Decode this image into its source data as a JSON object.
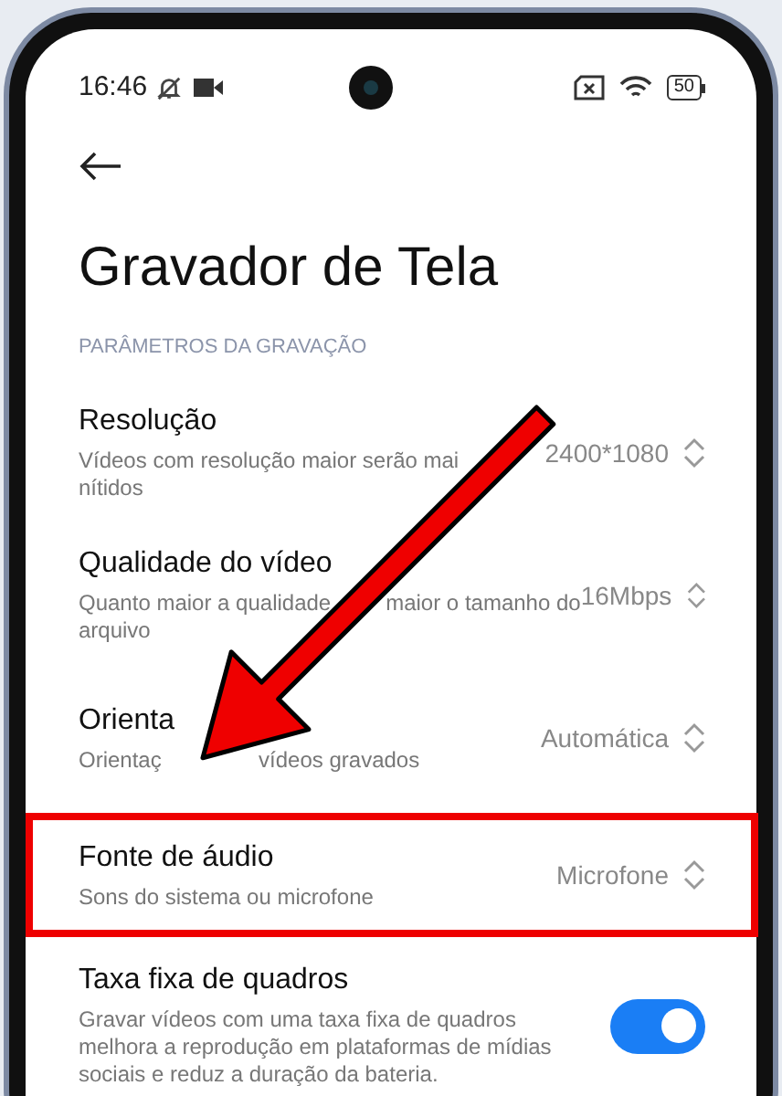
{
  "status_bar": {
    "time": "16:46",
    "battery": "50"
  },
  "title": "Gravador de Tela",
  "section_header": "PARÂMETROS DA GRAVAÇÃO",
  "settings": [
    {
      "kind": "select",
      "title": "Resolução",
      "description_lines": [
        [
          "Vídeos com resolução maior serão mai"
        ],
        [
          "nítidos"
        ]
      ],
      "value": "2400*1080",
      "highlighted": false
    },
    {
      "kind": "select",
      "title": "Qualidade do vídeo",
      "description_lines": [
        [
          "Quanto maior a qualidade",
          "maior o tamanho do"
        ],
        [
          "arquivo"
        ]
      ],
      "value": "16Mbps",
      "highlighted": false
    },
    {
      "kind": "select",
      "title": "Orienta",
      "description_lines": [
        [
          "Orientaç",
          "vídeos gravados"
        ]
      ],
      "value": "Automática",
      "highlighted": false
    },
    {
      "kind": "select",
      "title": "Fonte de áudio",
      "description_lines": [
        [
          "Sons do sistema ou microfone"
        ]
      ],
      "value": "Microfone",
      "highlighted": true
    },
    {
      "kind": "toggle",
      "title": "Taxa fixa de quadros",
      "description_lines": [
        [
          "Gravar vídeos com uma taxa fixa de quadros"
        ],
        [
          "melhora a reprodução em plataformas de mídias"
        ],
        [
          "sociais e reduz a duração da bateria."
        ]
      ],
      "on": true,
      "highlighted": false
    }
  ]
}
